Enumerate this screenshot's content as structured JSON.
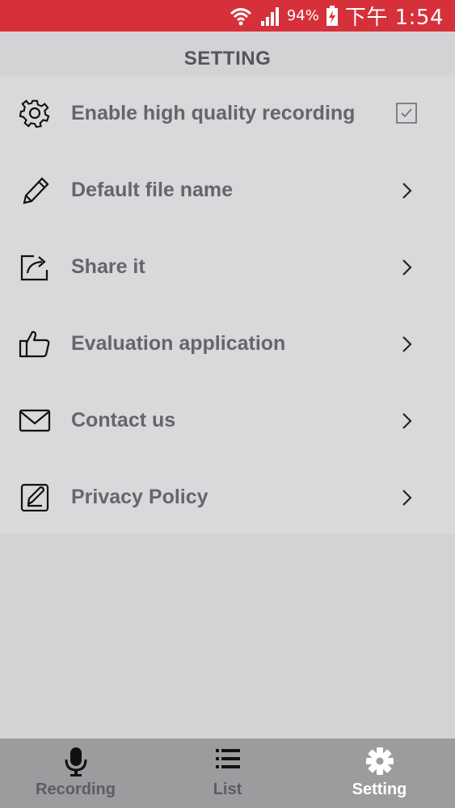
{
  "status_bar": {
    "battery_percent": "94%",
    "time": "下午 1:54"
  },
  "header": {
    "title": "SETTING"
  },
  "settings": [
    {
      "label": "Enable high quality recording",
      "icon": "gear-icon",
      "control": "checkbox",
      "checked": true
    },
    {
      "label": "Default file name",
      "icon": "pencil-icon",
      "control": "chevron"
    },
    {
      "label": "Share it",
      "icon": "share-icon",
      "control": "chevron"
    },
    {
      "label": "Evaluation application",
      "icon": "thumbs-up-icon",
      "control": "chevron"
    },
    {
      "label": "Contact us",
      "icon": "envelope-icon",
      "control": "chevron"
    },
    {
      "label": "Privacy Policy",
      "icon": "edit-document-icon",
      "control": "chevron"
    }
  ],
  "bottom_nav": {
    "tabs": [
      {
        "label": "Recording",
        "icon": "microphone-icon",
        "active": false
      },
      {
        "label": "List",
        "icon": "list-icon",
        "active": false
      },
      {
        "label": "Setting",
        "icon": "gear-icon",
        "active": true
      }
    ]
  },
  "colors": {
    "status_bar": "#d6303a",
    "background": "#d3d3d5",
    "bottom_nav": "#9c9c9f",
    "text": "#66666a"
  }
}
